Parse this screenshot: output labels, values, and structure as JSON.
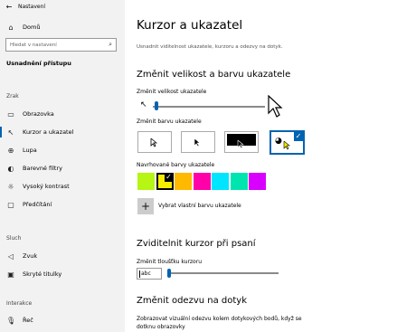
{
  "window": {
    "title": "Nastavení"
  },
  "sidebar": {
    "home_label": "Domů",
    "search_placeholder": "Hledat v nastavení",
    "top_item": "Usnadnění přístupu",
    "section_vision": "Zrak",
    "items": [
      {
        "label": "Obrazovka",
        "icon": "monitor-icon"
      },
      {
        "label": "Kurzor a ukazatel",
        "icon": "cursor-icon"
      },
      {
        "label": "Lupa",
        "icon": "magnifier-icon"
      },
      {
        "label": "Barevné filtry",
        "icon": "color-filter-icon"
      },
      {
        "label": "Vysoký kontrast",
        "icon": "contrast-icon"
      },
      {
        "label": "Předčítání",
        "icon": "narrator-icon"
      }
    ],
    "section_hearing": "Sluch",
    "hearing_items": [
      {
        "label": "Zvuk",
        "icon": "speaker-icon"
      },
      {
        "label": "Skryté titulky",
        "icon": "captions-icon"
      }
    ],
    "section_interaction": "Interakce",
    "interaction_items": [
      {
        "label": "Řeč",
        "icon": "microphone-icon"
      }
    ]
  },
  "main": {
    "title": "Kurzor a ukazatel",
    "subtitle": "Usnadnit viditelnost ukazatele, kurzoru a odezvy na dotyk.",
    "size_color_heading": "Změnit velikost a barvu ukazatele",
    "size_label": "Změnit velikost ukazatele",
    "pointer_size_fraction": 0.02,
    "color_label": "Změnit barvu ukazatele",
    "suggested_label": "Navrhované barvy ukazatele",
    "suggested_colors": [
      "#b6f514",
      "#f8ef00",
      "#ffb900",
      "#ff00a9",
      "#00e5ff",
      "#00e5b0",
      "#d800ff"
    ],
    "selected_suggested_index": 1,
    "custom_color_label": "Vybrat vlastní barvu ukazatele",
    "text_cursor_heading": "Zviditelnit kurzor při psaní",
    "cursor_thickness_label": "Změnit tloušťku kurzoru",
    "cursor_preview_text": "abc",
    "cursor_thickness_fraction": 0.0,
    "touch_heading": "Změnit odezvu na dotyk",
    "touch_description": "Zobrazovat vizuální odezvu kolem dotykových bodů, když se dotknu obrazovky"
  },
  "colors": {
    "accent": "#0063b1",
    "sidebar_bg": "#f2f2f2"
  }
}
